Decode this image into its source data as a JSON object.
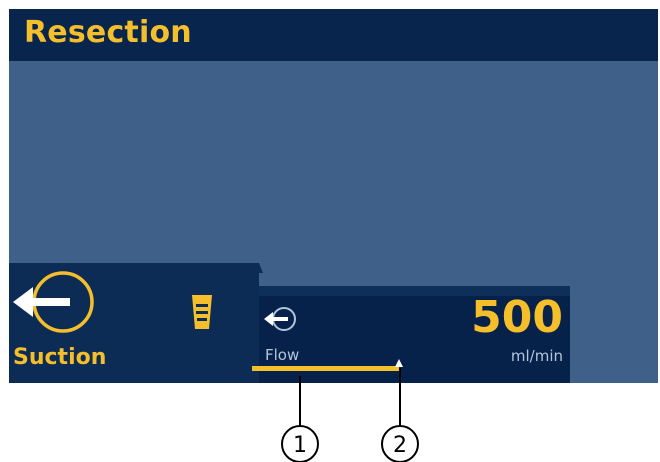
{
  "header": {
    "title": "Resection"
  },
  "suction": {
    "label": "Suction",
    "icon": "suction-arrow-icon",
    "canister_icon": "canister-icon"
  },
  "flow": {
    "label": "Flow",
    "value": "500",
    "unit": "ml/min",
    "icon": "flow-arrow-icon",
    "level_fraction": 0.45
  },
  "callouts": [
    {
      "number": "1"
    },
    {
      "number": "2"
    }
  ],
  "colors": {
    "accent": "#f5bf2c",
    "title_bar": "#08254d",
    "background": "#3f6089",
    "panel": "#07224a",
    "secondary_text": "#b3c5dc"
  }
}
